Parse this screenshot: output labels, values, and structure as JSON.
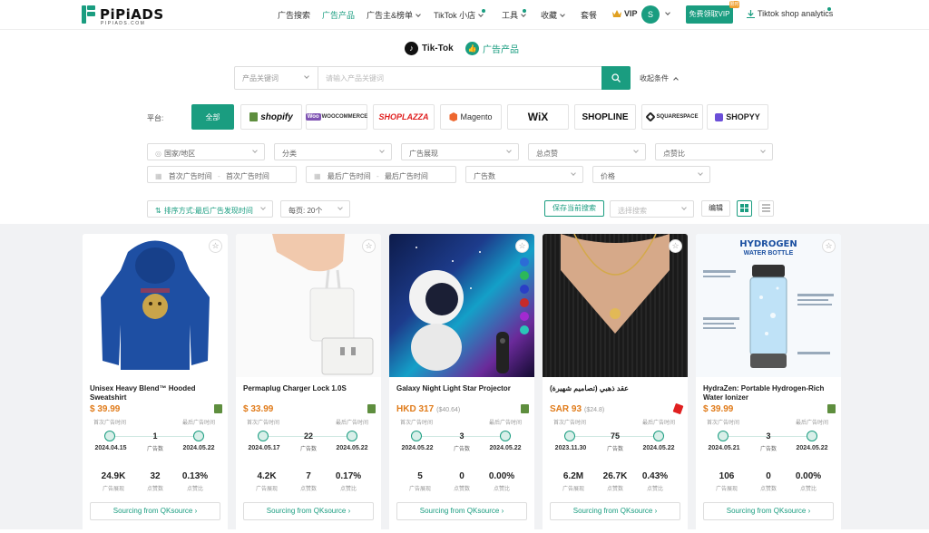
{
  "brand": {
    "name": "PiPiADS",
    "sub": "PIPIADS.COM",
    "accent": "#1a9d80"
  },
  "nav": {
    "items": [
      {
        "label": "广告搜索",
        "active": false
      },
      {
        "label": "广告产品",
        "active": true
      },
      {
        "label": "广告主&榜单",
        "active": false
      },
      {
        "label": "TikTok 小店",
        "active": false
      },
      {
        "label": "工具",
        "active": false
      },
      {
        "label": "收藏",
        "active": false
      },
      {
        "label": "套餐",
        "active": false
      }
    ],
    "vip": "VIP",
    "avatar": "S",
    "vip_button": "免费领取VIP",
    "vip_badge": "限时",
    "analytics": "Tiktok shop analytics"
  },
  "platform_tabs": {
    "tiktok": "Tik-Tok",
    "ad_products": "广告产品"
  },
  "search": {
    "scope": "产品关键词",
    "placeholder": "请输入产品关键词",
    "collapse": "收起条件"
  },
  "platforms": {
    "label": "平台:",
    "items": [
      "全部",
      "shopify",
      "WOOCOMMERCE",
      "SHOPLAZZA",
      "Magento",
      "WiX",
      "SHOPLINE",
      "SQUARESPACE",
      "SHOPYY"
    ]
  },
  "filters": {
    "row1": [
      "国家/地区",
      "分类",
      "广告展现",
      "总点赞",
      "点赞比"
    ],
    "first_seen_from": "首次广告时间",
    "first_seen_to": "首次广告时间",
    "last_seen_from": "最后广告时间",
    "last_seen_to": "最后广告时间",
    "ad_count": "广告数",
    "price": "价格"
  },
  "toolbar": {
    "sort": "排序方式:最后广告发现时间",
    "per_page": "每页: 20个",
    "save": "保存当前搜索",
    "saved_search": "选择搜索",
    "edit": "编辑"
  },
  "labels": {
    "first_ad": "首次广告时间",
    "last_ad": "最后广告时间",
    "ad_count": "广告数",
    "impressions": "广告展现",
    "likes": "点赞数",
    "like_ratio": "点赞比",
    "sourcing": "Sourcing from QKsource"
  },
  "products": [
    {
      "title": "Unisex Heavy Blend™ Hooded Sweatshirt",
      "price": "$ 39.99",
      "price_usd": "",
      "first_date": "2024.04.15",
      "ad_count": "1",
      "last_date": "2024.05.22",
      "impressions": "24.9K",
      "likes": "32",
      "like_ratio": "0.13%",
      "shop": "shopify"
    },
    {
      "title": "Permaplug Charger Lock 1.0S",
      "price": "$ 33.99",
      "price_usd": "",
      "first_date": "2024.05.17",
      "ad_count": "22",
      "last_date": "2024.05.22",
      "impressions": "4.2K",
      "likes": "7",
      "like_ratio": "0.17%",
      "shop": "shopify"
    },
    {
      "title": "Galaxy Night Light Star Projector",
      "price": "HKD 317",
      "price_usd": "($40.64)",
      "first_date": "2024.05.22",
      "ad_count": "3",
      "last_date": "2024.05.22",
      "impressions": "5",
      "likes": "0",
      "like_ratio": "0.00%",
      "shop": "shopify"
    },
    {
      "title": "عقد ذهبي (تصاميم شهيرة)",
      "price": "SAR 93",
      "price_usd": "($24.8)",
      "first_date": "2023.11.30",
      "ad_count": "75",
      "last_date": "2024.05.22",
      "impressions": "6.2M",
      "likes": "26.7K",
      "like_ratio": "0.43%",
      "shop": "shoplazza"
    },
    {
      "title": "HydraZen: Portable Hydrogen-Rich Water Ionizer",
      "price": "$ 39.99",
      "price_usd": "",
      "first_date": "2024.05.21",
      "ad_count": "3",
      "last_date": "2024.05.22",
      "impressions": "106",
      "likes": "0",
      "like_ratio": "0.00%",
      "shop": "shopify"
    }
  ],
  "bottle_text": {
    "title1": "HYDROGEN",
    "title2": "WATER BOTTLE"
  }
}
